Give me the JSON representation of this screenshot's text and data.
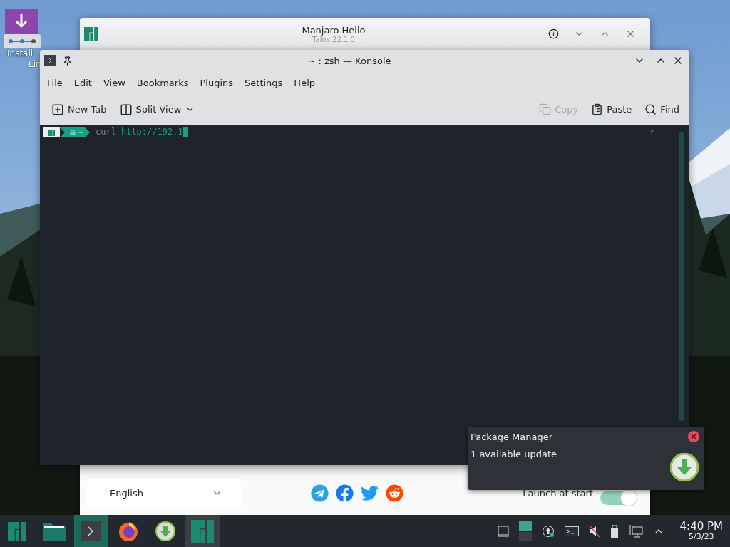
{
  "desktop": {
    "icon_label": [
      "Install",
      "Lin"
    ]
  },
  "hello_window": {
    "title": "Manjaro Hello",
    "subtitle": "Talos 22.1.0",
    "language": "English",
    "launch_at_start": {
      "label": "Launch at start",
      "on": true
    }
  },
  "konsole": {
    "title": "~ : zsh — Konsole",
    "menu": [
      "File",
      "Edit",
      "View",
      "Bookmarks",
      "Plugins",
      "Settings",
      "Help"
    ],
    "toolbar_left": [
      {
        "label": "New Tab",
        "kind": "newtab"
      },
      {
        "label": "Split View",
        "kind": "split"
      }
    ],
    "toolbar_right": [
      {
        "label": "Copy",
        "kind": "copy",
        "disabled": true
      },
      {
        "label": "Paste",
        "kind": "paste",
        "disabled": false
      },
      {
        "label": "Find",
        "kind": "find",
        "disabled": false
      }
    ],
    "prompt": {
      "dir": "~",
      "command": "curl",
      "argument": "http://192.1",
      "status": "✔"
    }
  },
  "notification": {
    "title": "Package Manager",
    "body": "1 available update"
  },
  "taskbar": {
    "apps": [
      {
        "kind": "menu",
        "open": false,
        "selected": false
      },
      {
        "kind": "files",
        "open": false,
        "selected": false
      },
      {
        "kind": "terminal",
        "open": true,
        "selected": true
      },
      {
        "kind": "browser",
        "open": false,
        "selected": false
      },
      {
        "kind": "updater",
        "open": false,
        "selected": false
      },
      {
        "kind": "hello",
        "open": true,
        "selected": false
      }
    ],
    "clock": {
      "time": "4:40 PM",
      "date": "5/3/23"
    }
  }
}
